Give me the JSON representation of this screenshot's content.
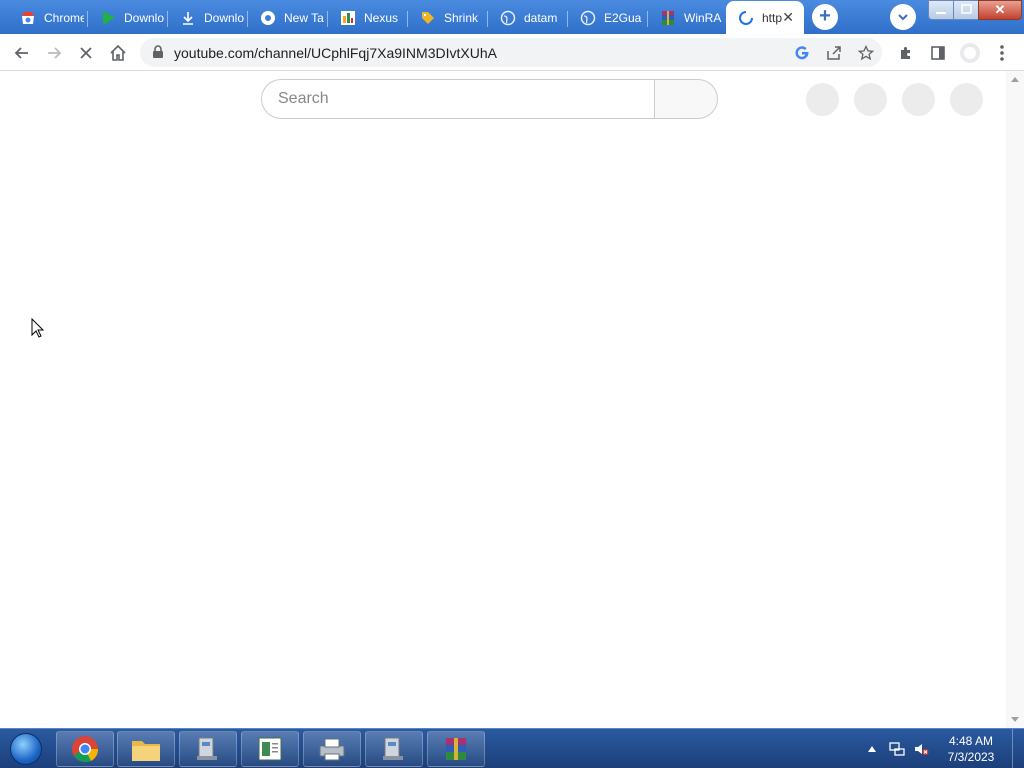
{
  "tabs": [
    {
      "label": "Chrome",
      "icon": "chrome-web-store-icon"
    },
    {
      "label": "Downlo",
      "icon": "play-icon"
    },
    {
      "label": "Downlo",
      "icon": "download-icon"
    },
    {
      "label": "New Ta",
      "icon": "chrome-icon"
    },
    {
      "label": "Nexus",
      "icon": "nexus-icon"
    },
    {
      "label": "Shrink",
      "icon": "tag-icon"
    },
    {
      "label": "datam",
      "icon": "globe-icon"
    },
    {
      "label": "E2Gua",
      "icon": "globe-icon"
    },
    {
      "label": "WinRA",
      "icon": "winrar-icon"
    },
    {
      "label": "http",
      "icon": "loading-spinner-icon",
      "active": true
    }
  ],
  "address_bar": {
    "url": "youtube.com/channel/UCphlFqj7Xa9INM3DIvtXUhA"
  },
  "page": {
    "search_placeholder": "Search"
  },
  "taskbar": {
    "items": [
      "chrome-icon",
      "file-explorer-icon",
      "app-icon",
      "document-icon",
      "printer-icon",
      "app-icon",
      "winrar-icon"
    ],
    "clock_time": "4:48 AM",
    "clock_date": "7/3/2023"
  },
  "colors": {
    "tabstrip": "#3c7dd9",
    "taskbar": "#1c3f7a",
    "accent": "#1a73e8"
  }
}
